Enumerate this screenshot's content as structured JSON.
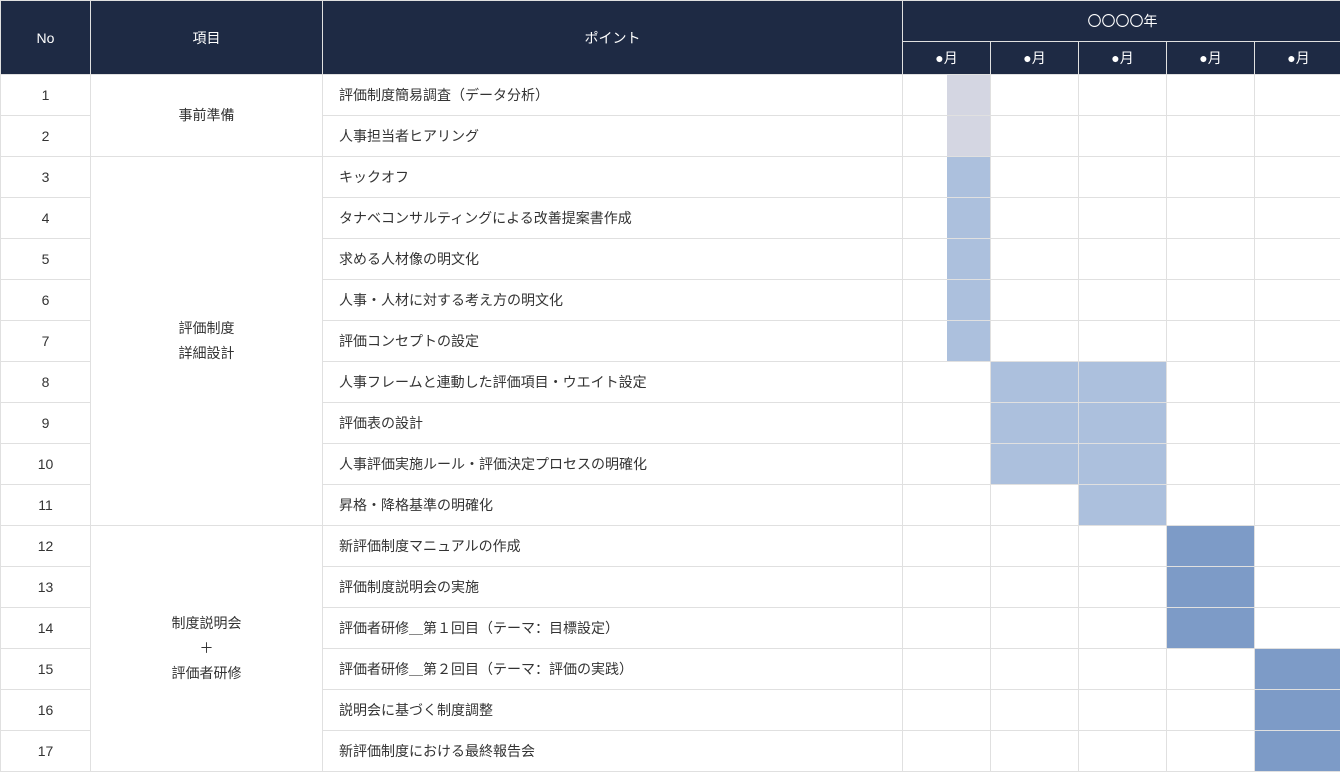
{
  "headers": {
    "no": "No",
    "item": "項目",
    "point": "ポイント",
    "year": "〇〇〇〇年",
    "months": [
      "●月",
      "●月",
      "●月",
      "●月",
      "●月"
    ]
  },
  "groups": [
    {
      "label": "事前準備",
      "start": 1,
      "span": 2
    },
    {
      "label": "評価制度\n詳細設計",
      "start": 3,
      "span": 9
    },
    {
      "label": "制度説明会\n＋\n評価者研修",
      "start": 12,
      "span": 6
    }
  ],
  "rows": [
    {
      "no": 1,
      "point": "評価制度簡易調査（データ分析）",
      "bars": [
        {
          "col": 0,
          "w": "w50",
          "pos": "right",
          "color": "c-lightest"
        }
      ]
    },
    {
      "no": 2,
      "point": "人事担当者ヒアリング",
      "bars": [
        {
          "col": 0,
          "w": "w50",
          "pos": "right",
          "color": "c-lightest"
        }
      ]
    },
    {
      "no": 3,
      "point": "キックオフ",
      "bars": [
        {
          "col": 0,
          "w": "w50",
          "pos": "right",
          "color": "c-light"
        }
      ]
    },
    {
      "no": 4,
      "point": "タナベコンサルティングによる改善提案書作成",
      "bars": [
        {
          "col": 0,
          "w": "w50",
          "pos": "right",
          "color": "c-light"
        }
      ]
    },
    {
      "no": 5,
      "point": "求める人材像の明文化",
      "bars": [
        {
          "col": 0,
          "w": "w50",
          "pos": "right",
          "color": "c-light"
        }
      ]
    },
    {
      "no": 6,
      "point": "人事・人材に対する考え方の明文化",
      "bars": [
        {
          "col": 0,
          "w": "w50",
          "pos": "right",
          "color": "c-light"
        }
      ]
    },
    {
      "no": 7,
      "point": "評価コンセプトの設定",
      "bars": [
        {
          "col": 0,
          "w": "w50",
          "pos": "right",
          "color": "c-light"
        }
      ]
    },
    {
      "no": 8,
      "point": "人事フレームと連動した評価項目・ウエイト設定",
      "bars": [
        {
          "col": 1,
          "w": "",
          "pos": "",
          "color": "c-light"
        },
        {
          "col": 2,
          "w": "",
          "pos": "",
          "color": "c-light"
        }
      ]
    },
    {
      "no": 9,
      "point": "評価表の設計",
      "bars": [
        {
          "col": 1,
          "w": "",
          "pos": "",
          "color": "c-light"
        },
        {
          "col": 2,
          "w": "",
          "pos": "",
          "color": "c-light"
        }
      ]
    },
    {
      "no": 10,
      "point": "人事評価実施ルール・評価決定プロセスの明確化",
      "bars": [
        {
          "col": 1,
          "w": "",
          "pos": "",
          "color": "c-light"
        },
        {
          "col": 2,
          "w": "",
          "pos": "",
          "color": "c-light"
        }
      ]
    },
    {
      "no": 11,
      "point": "昇格・降格基準の明確化",
      "bars": [
        {
          "col": 2,
          "w": "",
          "pos": "",
          "color": "c-light"
        }
      ]
    },
    {
      "no": 12,
      "point": "新評価制度マニュアルの作成",
      "bars": [
        {
          "col": 3,
          "w": "",
          "pos": "",
          "color": "c-mid"
        }
      ]
    },
    {
      "no": 13,
      "point": "評価制度説明会の実施",
      "bars": [
        {
          "col": 3,
          "w": "",
          "pos": "",
          "color": "c-mid"
        }
      ]
    },
    {
      "no": 14,
      "point": "評価者研修＿第１回目（テーマ：目標設定）",
      "bars": [
        {
          "col": 3,
          "w": "",
          "pos": "",
          "color": "c-mid"
        }
      ]
    },
    {
      "no": 15,
      "point": "評価者研修＿第２回目（テーマ：評価の実践）",
      "bars": [
        {
          "col": 4,
          "w": "",
          "pos": "",
          "color": "c-mid"
        }
      ]
    },
    {
      "no": 16,
      "point": "説明会に基づく制度調整",
      "bars": [
        {
          "col": 4,
          "w": "",
          "pos": "",
          "color": "c-mid"
        }
      ]
    },
    {
      "no": 17,
      "point": "新評価制度における最終報告会",
      "bars": [
        {
          "col": 4,
          "w": "",
          "pos": "",
          "color": "c-mid"
        }
      ]
    }
  ]
}
